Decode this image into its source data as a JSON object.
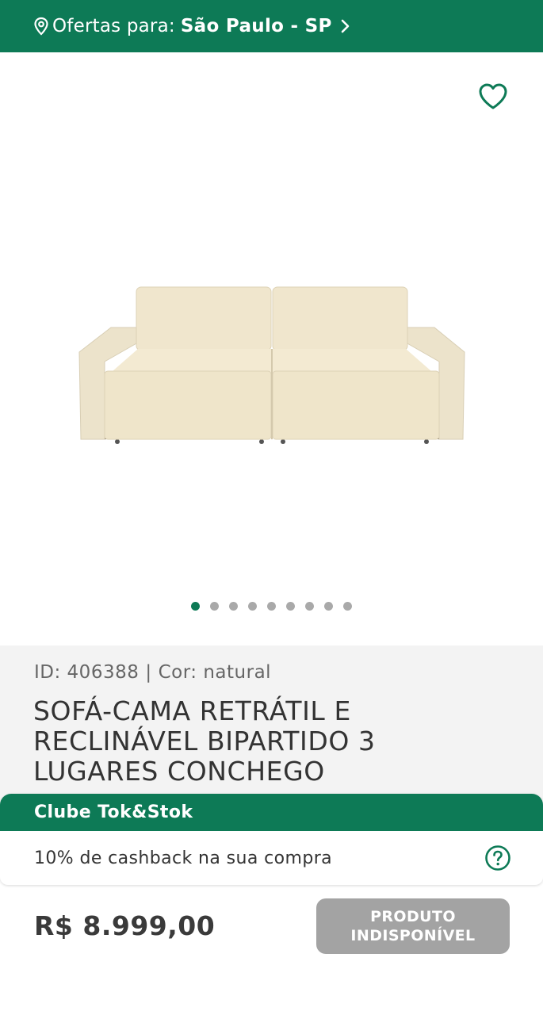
{
  "location_bar": {
    "prefix": "Ofertas para:",
    "city": "São Paulo - SP",
    "pin_icon": "map-pin-icon",
    "chevron_icon": "chevron-right-icon"
  },
  "gallery": {
    "favorite_icon": "heart-outline-icon",
    "image_description": "sofa",
    "slide_count": 9,
    "active_slide": 1
  },
  "product": {
    "meta_id": "ID: 406388",
    "meta_sep": "|",
    "meta_color": "Cor: natural",
    "title": "SOFÁ-CAMA RETRÁTIL E RECLINÁVEL BIPARTIDO 3 LUGARES CONCHEGO"
  },
  "club": {
    "title": "Clube Tok&Stok",
    "cashback": "10% de cashback na sua compra",
    "help_icon": "question-circle-icon"
  },
  "purchase": {
    "price": "R$ 8.999,00",
    "button_line1": "PRODUTO",
    "button_line2": "INDISPONÍVEL"
  },
  "colors": {
    "brand_green": "#0d7a56",
    "disabled_gray": "#a3a3a3",
    "info_bg": "#f3f3f3"
  }
}
